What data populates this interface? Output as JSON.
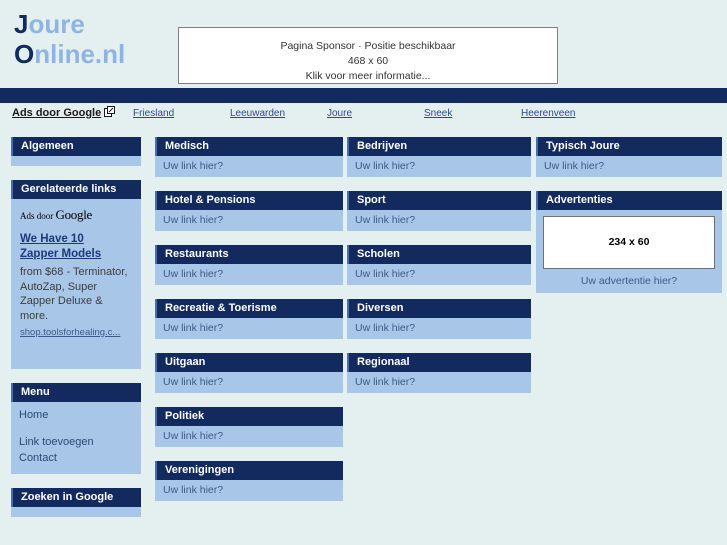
{
  "site": {
    "logo_line1_cap": "J",
    "logo_line1_rest": "oure",
    "logo_line2_cap": "O",
    "logo_line2_rest": "nline.nl"
  },
  "sponsor": {
    "line1": "Pagina Sponsor · Positie beschikbaar",
    "line2": "468 x 60",
    "line3": "Klik voor meer informatie..."
  },
  "adbar": {
    "label": "Ads door Google",
    "links": [
      {
        "label": "Friesland"
      },
      {
        "label": "Leeuwarden"
      },
      {
        "label": "Joure"
      },
      {
        "label": "Sneek"
      },
      {
        "label": "Heerenveen"
      }
    ]
  },
  "sidebar": {
    "algemeen": {
      "title": "Algemeen"
    },
    "gerelateerde": {
      "title": "Gerelateerde links",
      "ads_label_prefix": "Ads door ",
      "ads_label_brand": "Google",
      "ad_title_line1": "We Have 10",
      "ad_title_line2": "Zapper Models",
      "ad_text": "from $68 - Terminator, AutoZap, Super Zapper Deluxe & more.",
      "ad_url": "shop.toolsforhealing.c..."
    },
    "menu": {
      "title": "Menu",
      "items": [
        {
          "label": "Home"
        },
        {
          "label": "Link toevoegen"
        },
        {
          "label": "Contact"
        }
      ]
    },
    "zoeken": {
      "title": "Zoeken in Google"
    }
  },
  "columns": {
    "one": [
      {
        "title": "Medisch",
        "link": "Uw link hier?"
      },
      {
        "title": "Hotel & Pensions",
        "link": "Uw link hier?"
      },
      {
        "title": "Restaurants",
        "link": "Uw link hier?"
      },
      {
        "title": "Recreatie & Toerisme",
        "link": "Uw link hier?"
      },
      {
        "title": "Uitgaan",
        "link": "Uw link hier?"
      },
      {
        "title": "Politiek",
        "link": "Uw link hier?"
      },
      {
        "title": "Verenigingen",
        "link": "Uw link hier?"
      }
    ],
    "two": [
      {
        "title": "Bedrijven",
        "link": "Uw link hier?"
      },
      {
        "title": "Sport",
        "link": "Uw link hier?"
      },
      {
        "title": "Scholen",
        "link": "Uw link hier?"
      },
      {
        "title": "Diversen",
        "link": "Uw link hier?"
      },
      {
        "title": "Regionaal",
        "link": "Uw link hier?"
      }
    ],
    "three": {
      "typisch": {
        "title": "Typisch Joure",
        "link": "Uw link hier?"
      },
      "advertenties": {
        "title": "Advertenties",
        "slot_size": "234 x 60",
        "caption": "Uw advertentie hier?"
      }
    }
  },
  "colors": {
    "navy": "#122a5e",
    "light_blue": "#a8c6e8",
    "page_bg": "#e4f0f0",
    "logo_light": "#8fb4e2"
  }
}
